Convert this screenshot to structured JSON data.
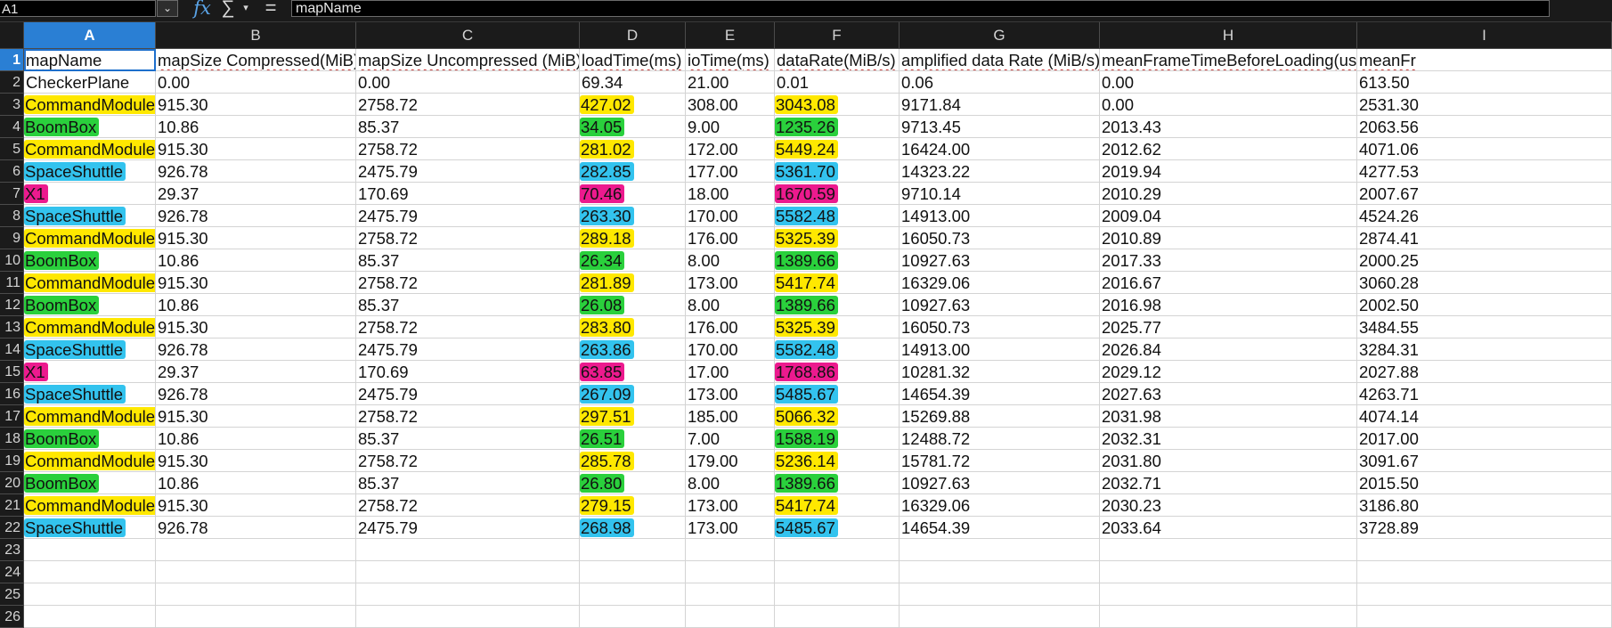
{
  "formula_bar": {
    "name_box": "A1",
    "formula": "mapName",
    "icons": [
      "function-wizard-icon",
      "sum-icon",
      "dropdown-icon",
      "equals-icon"
    ]
  },
  "highlight_colors": {
    "yellow": "#ffe800",
    "green": "#2ad03c",
    "blue": "#33c3ee",
    "pink": "#ec1a8e"
  },
  "selection_color": "#2a7fd4",
  "columns": [
    "A",
    "B",
    "C",
    "D",
    "E",
    "F",
    "G",
    "H",
    "I"
  ],
  "headers": [
    "mapName",
    "mapSize Compressed(MiB)",
    "mapSize Uncompressed (MiB)",
    "loadTime(ms)",
    "ioTime(ms)",
    "dataRate(MiB/s)",
    "amplified data Rate (MiB/s)",
    "meanFrameTimeBeforeLoading(us)",
    "meanFr"
  ],
  "rows": [
    [
      "CheckerPlane",
      "0.00",
      "0.00",
      "69.34",
      "21.00",
      "0.01",
      "0.06",
      "0.00",
      "613.50"
    ],
    [
      "CommandModule",
      "915.30",
      "2758.72",
      "427.02",
      "308.00",
      "3043.08",
      "9171.84",
      "0.00",
      "2531.30"
    ],
    [
      "BoomBox",
      "10.86",
      "85.37",
      "34.05",
      "9.00",
      "1235.26",
      "9713.45",
      "2013.43",
      "2063.56"
    ],
    [
      "CommandModule",
      "915.30",
      "2758.72",
      "281.02",
      "172.00",
      "5449.24",
      "16424.00",
      "2012.62",
      "4071.06"
    ],
    [
      "SpaceShuttle",
      "926.78",
      "2475.79",
      "282.85",
      "177.00",
      "5361.70",
      "14323.22",
      "2019.94",
      "4277.53"
    ],
    [
      "X1",
      "29.37",
      "170.69",
      "70.46",
      "18.00",
      "1670.59",
      "9710.14",
      "2010.29",
      "2007.67"
    ],
    [
      "SpaceShuttle",
      "926.78",
      "2475.79",
      "263.30",
      "170.00",
      "5582.48",
      "14913.00",
      "2009.04",
      "4524.26"
    ],
    [
      "CommandModule",
      "915.30",
      "2758.72",
      "289.18",
      "176.00",
      "5325.39",
      "16050.73",
      "2010.89",
      "2874.41"
    ],
    [
      "BoomBox",
      "10.86",
      "85.37",
      "26.34",
      "8.00",
      "1389.66",
      "10927.63",
      "2017.33",
      "2000.25"
    ],
    [
      "CommandModule",
      "915.30",
      "2758.72",
      "281.89",
      "173.00",
      "5417.74",
      "16329.06",
      "2016.67",
      "3060.28"
    ],
    [
      "BoomBox",
      "10.86",
      "85.37",
      "26.08",
      "8.00",
      "1389.66",
      "10927.63",
      "2016.98",
      "2002.50"
    ],
    [
      "CommandModule",
      "915.30",
      "2758.72",
      "283.80",
      "176.00",
      "5325.39",
      "16050.73",
      "2025.77",
      "3484.55"
    ],
    [
      "SpaceShuttle",
      "926.78",
      "2475.79",
      "263.86",
      "170.00",
      "5582.48",
      "14913.00",
      "2026.84",
      "3284.31"
    ],
    [
      "X1",
      "29.37",
      "170.69",
      "63.85",
      "17.00",
      "1768.86",
      "10281.32",
      "2029.12",
      "2027.88"
    ],
    [
      "SpaceShuttle",
      "926.78",
      "2475.79",
      "267.09",
      "173.00",
      "5485.67",
      "14654.39",
      "2027.63",
      "4263.71"
    ],
    [
      "CommandModule",
      "915.30",
      "2758.72",
      "297.51",
      "185.00",
      "5066.32",
      "15269.88",
      "2031.98",
      "4074.14"
    ],
    [
      "BoomBox",
      "10.86",
      "85.37",
      "26.51",
      "7.00",
      "1588.19",
      "12488.72",
      "2032.31",
      "2017.00"
    ],
    [
      "CommandModule",
      "915.30",
      "2758.72",
      "285.78",
      "179.00",
      "5236.14",
      "15781.72",
      "2031.80",
      "3091.67"
    ],
    [
      "BoomBox",
      "10.86",
      "85.37",
      "26.80",
      "8.00",
      "1389.66",
      "10927.63",
      "2032.71",
      "2015.50"
    ],
    [
      "CommandModule",
      "915.30",
      "2758.72",
      "279.15",
      "173.00",
      "5417.74",
      "16329.06",
      "2030.23",
      "3186.80"
    ],
    [
      "SpaceShuttle",
      "926.78",
      "2475.79",
      "268.98",
      "173.00",
      "5485.67",
      "14654.39",
      "2033.64",
      "3728.89"
    ]
  ],
  "row_numbers": [
    "1",
    "2",
    "3",
    "4",
    "5",
    "6",
    "7",
    "8",
    "9",
    "10",
    "11",
    "12",
    "13",
    "14",
    "15",
    "16",
    "17",
    "18",
    "19",
    "20",
    "21",
    "22",
    "23",
    "24",
    "25",
    "26"
  ],
  "row_highlights": [
    "",
    "yellow",
    "green",
    "yellow",
    "blue",
    "pink",
    "blue",
    "yellow",
    "green",
    "yellow",
    "green",
    "yellow",
    "blue",
    "pink",
    "blue",
    "yellow",
    "green",
    "yellow",
    "green",
    "yellow",
    "blue"
  ],
  "highlighted_columns": [
    0,
    3,
    5
  ]
}
